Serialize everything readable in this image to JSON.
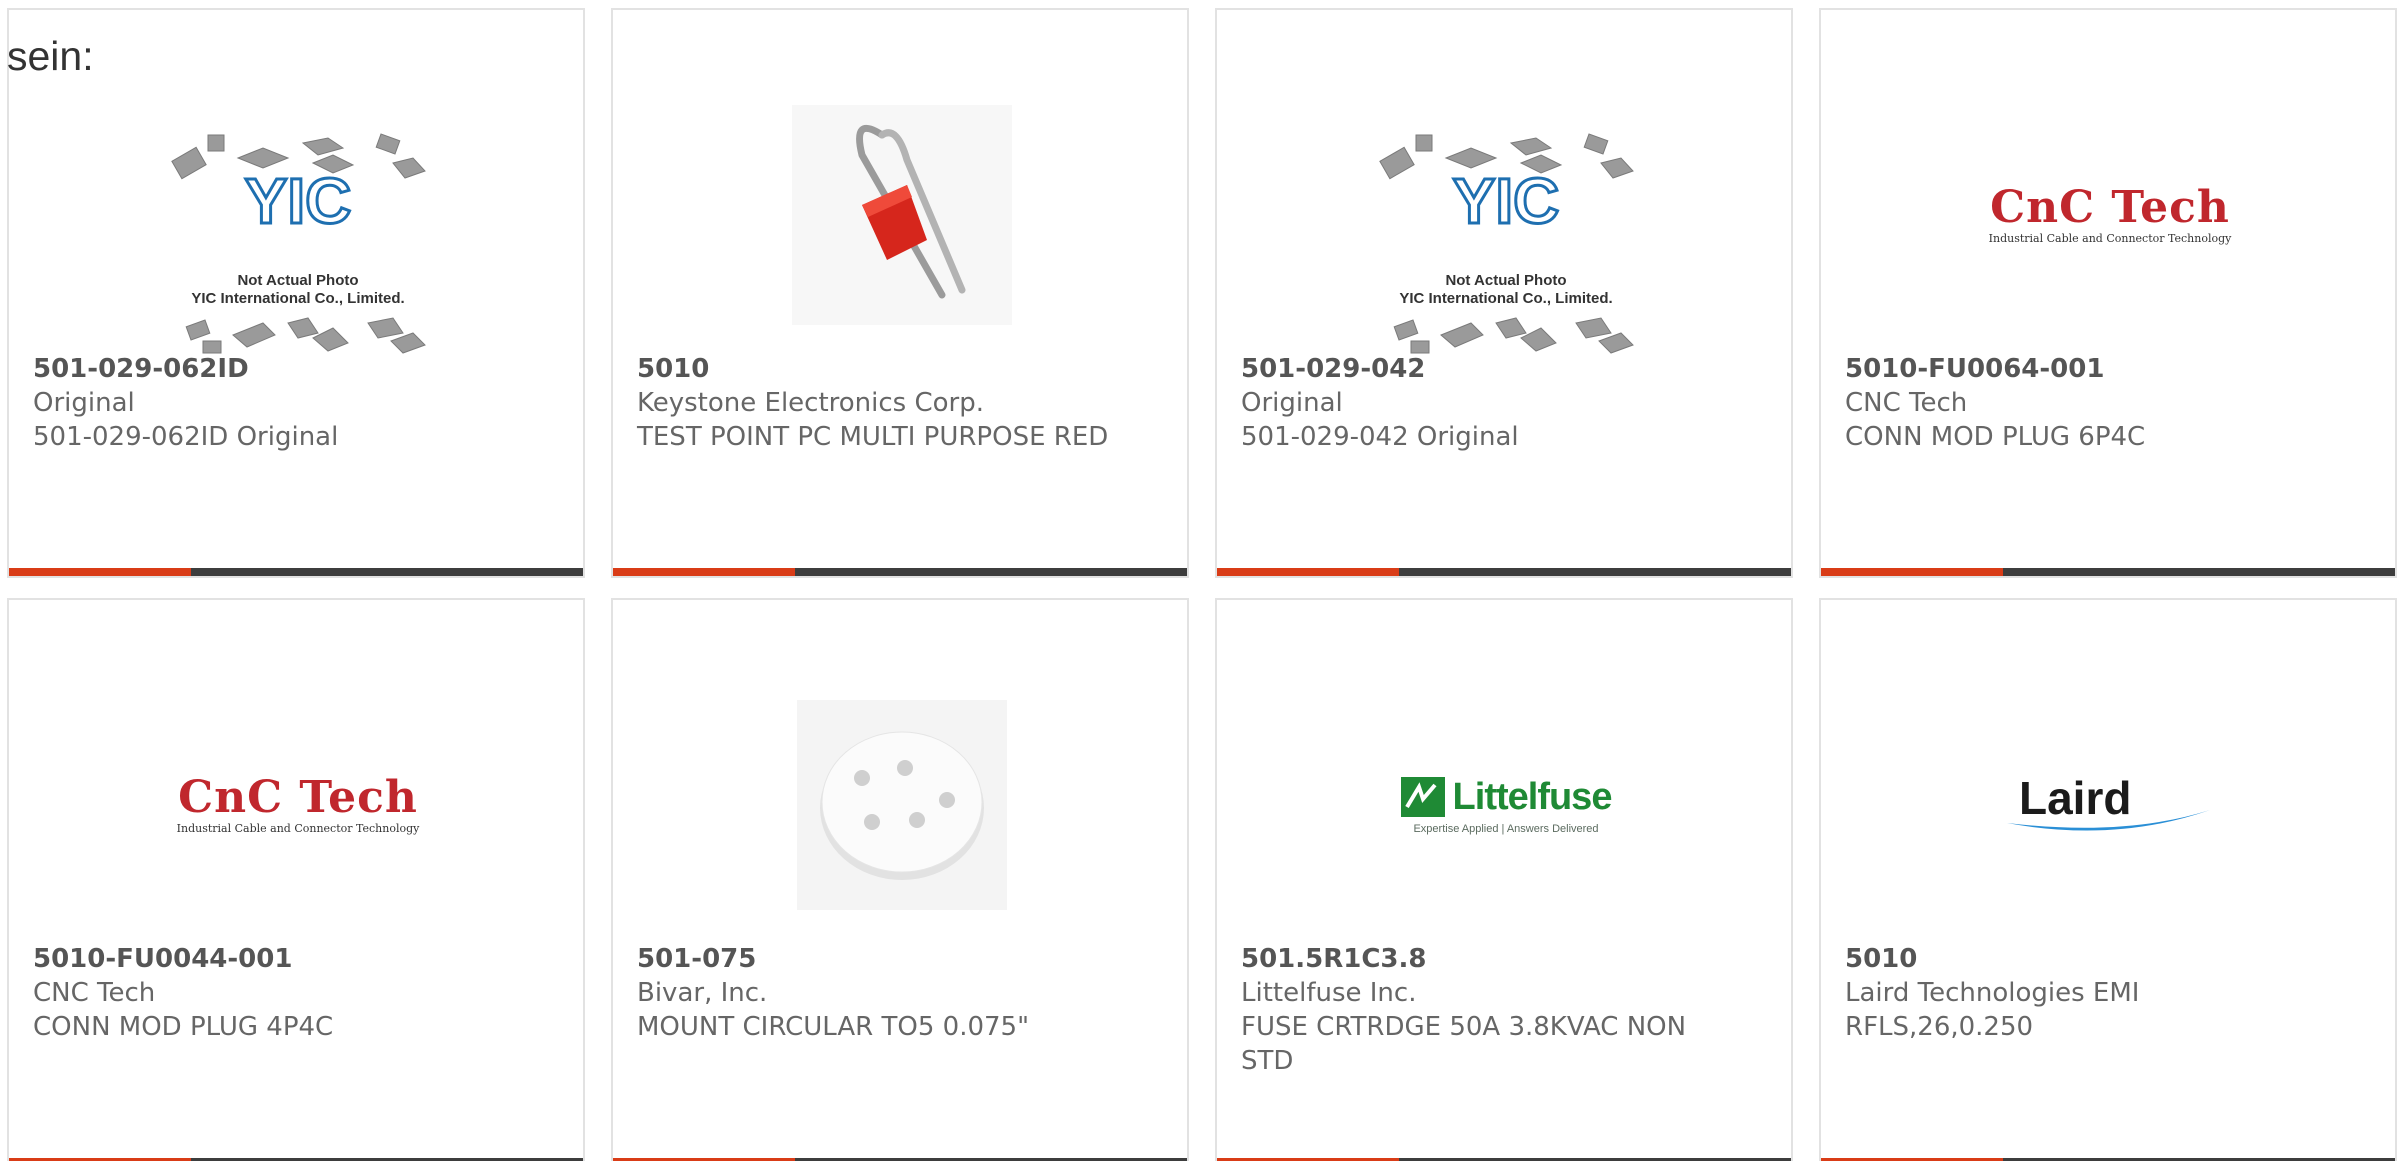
{
  "lead_text": "sein:",
  "products": [
    {
      "part_number": "501-029-062ID",
      "manufacturer": "Original",
      "description": "501-029-062ID Original",
      "image": "yic-placeholder",
      "yic_caption_1": "Not Actual Photo",
      "yic_caption_2": "YIC International Co., Limited."
    },
    {
      "part_number": "5010",
      "manufacturer": "Keystone Electronics Corp.",
      "description": "TEST POINT PC MULTI PURPOSE RED",
      "image": "test-point-photo"
    },
    {
      "part_number": "501-029-042",
      "manufacturer": "Original",
      "description": "501-029-042 Original",
      "image": "yic-placeholder",
      "yic_caption_1": "Not Actual Photo",
      "yic_caption_2": "YIC International Co., Limited."
    },
    {
      "part_number": "5010-FU0064-001",
      "manufacturer": "CNC Tech",
      "description": "CONN MOD PLUG 6P4C",
      "image": "cnc-tech-logo",
      "logo_main": "CnC Tech",
      "logo_sub": "Industrial Cable and Connector Technology"
    },
    {
      "part_number": "5010-FU0044-001",
      "manufacturer": "CNC Tech",
      "description": "CONN MOD PLUG 4P4C",
      "image": "cnc-tech-logo",
      "logo_main": "CnC Tech",
      "logo_sub": "Industrial Cable and Connector Technology"
    },
    {
      "part_number": "501-075",
      "manufacturer": "Bivar, Inc.",
      "description": "MOUNT CIRCULAR TO5 0.075\"",
      "image": "circular-mount-photo"
    },
    {
      "part_number": "501.5R1C3.8",
      "manufacturer": "Littelfuse Inc.",
      "description": "FUSE CRTRDGE 50A 3.8KVAC NON STD",
      "image": "littelfuse-logo",
      "logo_main": "Littelfuse",
      "logo_sub": "Expertise Applied | Answers Delivered"
    },
    {
      "part_number": "5010",
      "manufacturer": "Laird Technologies EMI",
      "description": "RFLS,26,0.250",
      "image": "laird-logo",
      "logo_main": "Laird"
    }
  ],
  "colors": {
    "accent": "#d93c17",
    "bar": "#3d3d3d",
    "border": "#e2e2e2",
    "text": "#666666",
    "cnc_red": "#c0272d",
    "littelfuse_green": "#1f8a35",
    "laird_blue": "#2a8fd6"
  }
}
